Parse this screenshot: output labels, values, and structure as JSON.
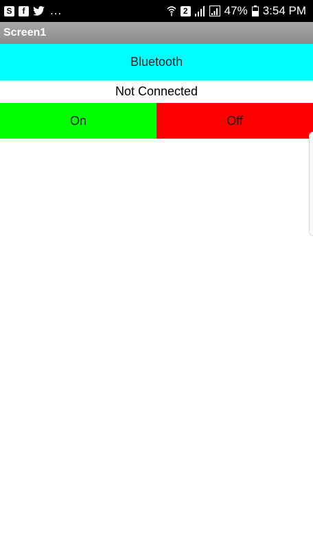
{
  "status_bar": {
    "left_icons": [
      "shazam-icon",
      "facebook-icon",
      "twitter-icon"
    ],
    "ellipsis": "...",
    "sim_badge": "2",
    "battery_percent": "47%",
    "time": "3:54 PM"
  },
  "title_bar": {
    "title": "Screen1"
  },
  "bluetooth_button": {
    "label": "Bluetooth",
    "color": "#00ffff"
  },
  "connection_status": {
    "text": "Not Connected"
  },
  "on_button": {
    "label": "On",
    "color": "#00ff00"
  },
  "off_button": {
    "label": "Off",
    "color": "#ff0000"
  }
}
